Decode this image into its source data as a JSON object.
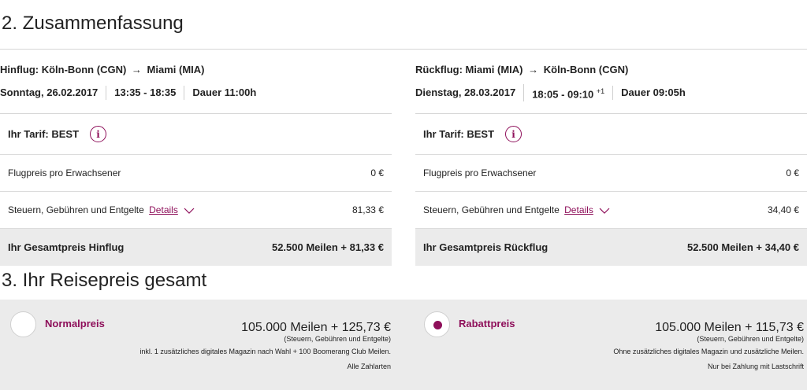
{
  "headings": {
    "summary": "2. Zusammenfassung",
    "total": "3. Ihr Reisepreis gesamt"
  },
  "outbound": {
    "route_label": "Hinflug: Köln-Bonn (CGN)",
    "arrow": "→",
    "route_dest": "Miami (MIA)",
    "date": "Sonntag, 26.02.2017",
    "time": "13:35 - 18:35",
    "time_sup": "",
    "duration": "Dauer 11:00h",
    "tariff": "Ihr Tarif: BEST",
    "fare_label": "Flugpreis pro Erwachsener",
    "fare_value": "0 €",
    "taxes_label": "Steuern, Gebühren und Entgelte",
    "details_link": "Details",
    "taxes_value": "81,33 €",
    "total_label": "Ihr Gesamtpreis Hinflug",
    "total_value": "52.500 Meilen + 81,33 €"
  },
  "return": {
    "route_label": "Rückflug: Miami (MIA)",
    "arrow": "→",
    "route_dest": "Köln-Bonn (CGN)",
    "date": "Dienstag, 28.03.2017",
    "time": "18:05 - 09:10",
    "time_sup": "+1",
    "duration": "Dauer 09:05h",
    "tariff": "Ihr Tarif: BEST",
    "fare_label": "Flugpreis pro Erwachsener",
    "fare_value": "0 €",
    "taxes_label": "Steuern, Gebühren und Entgelte",
    "details_link": "Details",
    "taxes_value": "34,40 €",
    "total_label": "Ihr Gesamtpreis Rückflug",
    "total_value": "52.500 Meilen + 34,40 €"
  },
  "options": {
    "normal": {
      "name": "Normalpreis",
      "price": "105.000 Meilen + 125,73 €",
      "sub": "(Steuern, Gebühren und Entgelte)",
      "note": "inkl. 1 zusätzliches digitales Magazin nach Wahl + 100 Boomerang Club Meilen.",
      "payment": "Alle Zahlarten",
      "selected": false
    },
    "rabatt": {
      "name": "Rabattpreis",
      "price": "105.000 Meilen + 115,73 €",
      "sub": "(Steuern, Gebühren und Entgelte)",
      "note": "Ohne zusätzliches digitales Magazin und zusätzliche Meilen.",
      "payment": "Nur bei Zahlung mit Lastschrift",
      "selected": true
    }
  },
  "icons": {
    "info": "info-icon",
    "chevron": "chevron-down-icon"
  },
  "colors": {
    "accent": "#8e0f5a",
    "band": "#ebebeb",
    "rule": "#d6d6d6"
  }
}
